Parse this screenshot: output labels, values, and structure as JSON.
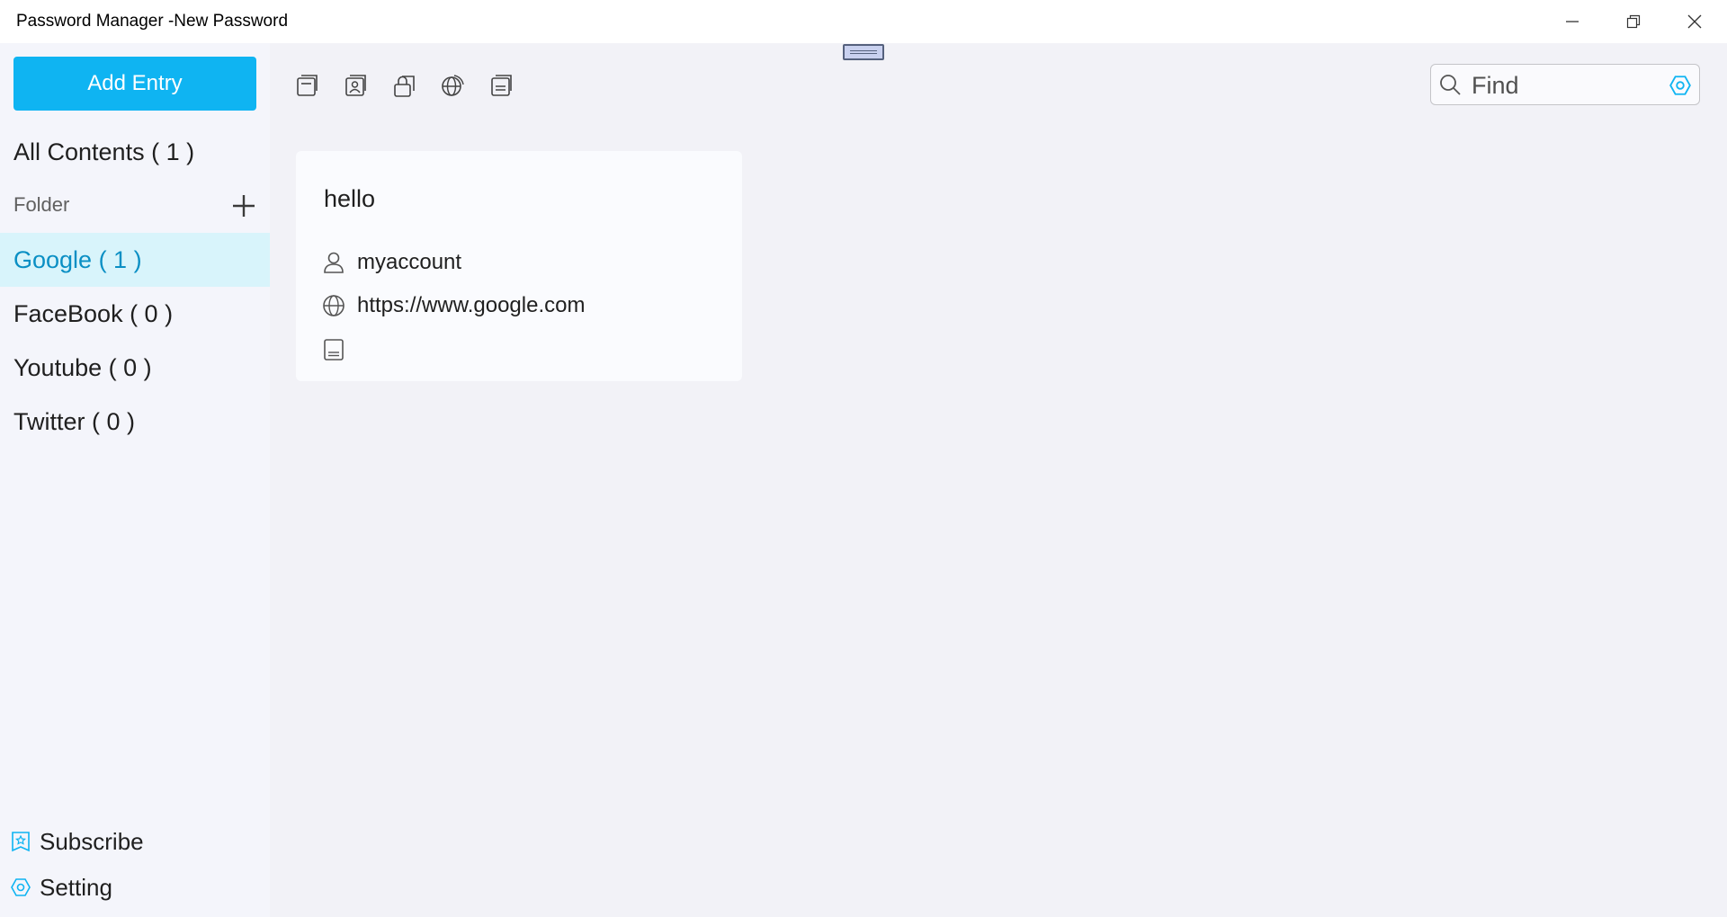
{
  "window": {
    "title": "Password Manager -New Password",
    "minimize_icon": "minimize-icon",
    "maximize_icon": "restore-icon",
    "close_icon": "close-icon"
  },
  "sidebar": {
    "add_entry_label": "Add Entry",
    "all_contents": {
      "label": "All Contents",
      "count": "( 1 )",
      "text": "All Contents ( 1 )"
    },
    "folder_header": "Folder",
    "folders": [
      {
        "text": "Google ( 1 )",
        "selected": true
      },
      {
        "text": "FaceBook ( 0 )",
        "selected": false
      },
      {
        "text": "Youtube ( 0 )",
        "selected": false
      },
      {
        "text": "Twitter ( 0 )",
        "selected": false
      }
    ],
    "footer": {
      "subscribe_label": "Subscribe",
      "setting_label": "Setting"
    }
  },
  "toolbar": {
    "buttons": [
      "all-entries-icon",
      "account-icon",
      "password-icon",
      "website-icon",
      "note-icon"
    ]
  },
  "search": {
    "placeholder": "Find",
    "value": ""
  },
  "entries": [
    {
      "title": "hello",
      "account": "myaccount",
      "url": "https://www.google.com",
      "note": ""
    }
  ],
  "colors": {
    "accent": "#0fb4f2",
    "selected_bg": "#d8f4fb",
    "selected_text": "#0a8fc4",
    "sidebar_bg": "#f4f5fb",
    "main_bg": "#f2f2f7",
    "card_bg": "#fafbfe"
  }
}
